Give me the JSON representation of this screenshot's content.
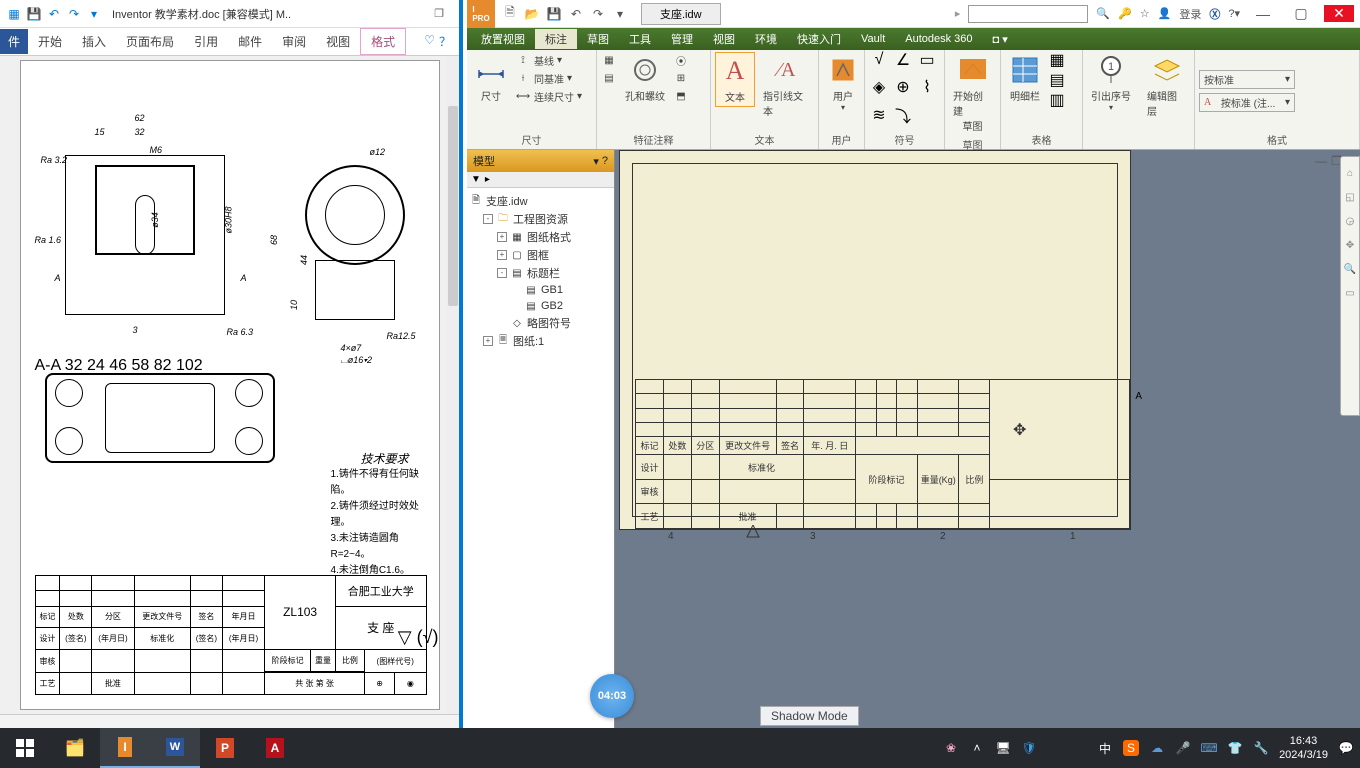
{
  "word": {
    "title": "Inventor 教学素材.doc [兼容模式] M..",
    "tabs": {
      "file": "件",
      "start": "开始",
      "insert": "插入",
      "layout": "页面布局",
      "ref": "引用",
      "mail": "邮件",
      "review": "审阅",
      "view": "视图",
      "format": "格式"
    },
    "drawing": {
      "dims": {
        "d62": "62",
        "d15": "15",
        "d32": "32",
        "dM6": "M6",
        "ra32": "Ra 3.2",
        "ra16": "Ra 1.6",
        "ra63": "Ra 6.3",
        "ra125": "Ra12.5",
        "phi34": "ø34",
        "phi30h8": "ø30H8",
        "d68": "68",
        "d44": "44",
        "d10": "10",
        "d3": "3",
        "phi12": "ø12",
        "aa": "A-A",
        "secA1": "A",
        "secA2": "A",
        "hole": "4×ø7",
        "cbore": "⌴ø16▾2",
        "d32b": "32",
        "d24": "24",
        "d46": "46",
        "d58": "58",
        "d82": "82",
        "d102": "102"
      },
      "tech_title": "技术要求",
      "tech_lines": [
        "1.铸件不得有任何缺陷。",
        "2.铸件须经过时效处理。",
        "3.未注铸造圆角R=2~4。",
        "4.未注倒角C1.6。"
      ],
      "check_mark": "√"
    },
    "titleblock": {
      "fields": [
        "标记",
        "处数",
        "分区",
        "更改文件号",
        "签名",
        "年月日"
      ],
      "fields2": [
        "设计",
        "(签名)",
        "(年月日)",
        "标准化",
        "(签名)",
        "(年月日)"
      ],
      "fields3": [
        "审核",
        "",
        "",
        "",
        "",
        ""
      ],
      "fields4": [
        "工艺",
        "",
        "批准",
        "",
        "",
        ""
      ],
      "stage": "阶段标记",
      "weight": "重量",
      "scale": "比例",
      "sheets": "共  张    第  张",
      "material": "ZL103",
      "school": "合肥工业大学",
      "part": "支  座",
      "code": "(图样代号)"
    }
  },
  "inventor": {
    "doc_tab": "支座.idw",
    "login": "登录",
    "menus": [
      "放置视图",
      "标注",
      "草图",
      "工具",
      "管理",
      "视图",
      "环境",
      "快速入门",
      "Vault",
      "Autodesk 360"
    ],
    "menu_active_idx": 1,
    "ribbon": {
      "dim_group": "尺寸",
      "dim_btn": "尺寸",
      "baseline": "基线",
      "same_base": "同基准",
      "chain": "连续尺寸",
      "feature_group": "特征注释",
      "ftn_hole": "孔和螺纹",
      "ftn_tol": "",
      "ftn_sym": "",
      "text_group": "文本",
      "text_btn": "文本",
      "leader_text": "指引线文本",
      "user_group": "用户",
      "user_btn": "用户",
      "symbol_group": "符号",
      "sketch_group": "草图",
      "sketch_start": "开始创建",
      "sketch_start2": "草图",
      "table_group": "表格",
      "parts_list": "明细栏",
      "seq_btn": "引出序号",
      "layer_group": "格式",
      "edit_layer": "编辑图层",
      "style_std": "按标准",
      "style_annot": "按标准 (注..."
    },
    "browser": {
      "header": "模型",
      "root": "支座.idw",
      "folder": "工程图资源",
      "children": [
        "图纸格式",
        "图框",
        "标题栏"
      ],
      "gb": [
        "GB1",
        "GB2"
      ],
      "sketch_symbol": "略图符号",
      "sheet": "图纸:1"
    },
    "sheet_tb": {
      "row_labels": [
        "标记",
        "处数",
        "分区",
        "更改文件号",
        "签名",
        "年. 月. 日"
      ],
      "design": "设计",
      "std": "标准化",
      "stage": "阶段标记",
      "weight": "重量(Kg)",
      "scale": "比例",
      "review": "审核",
      "tech": "工艺",
      "approve": "批准",
      "letterA": "A",
      "ruler": [
        "4",
        "3",
        "2",
        "1"
      ]
    }
  },
  "floating": {
    "timer": "04:03",
    "shadow": "Shadow Mode"
  },
  "tray": {
    "ime": "中",
    "sogou": "S",
    "clock": "16:43",
    "date": "2024/3/19"
  }
}
